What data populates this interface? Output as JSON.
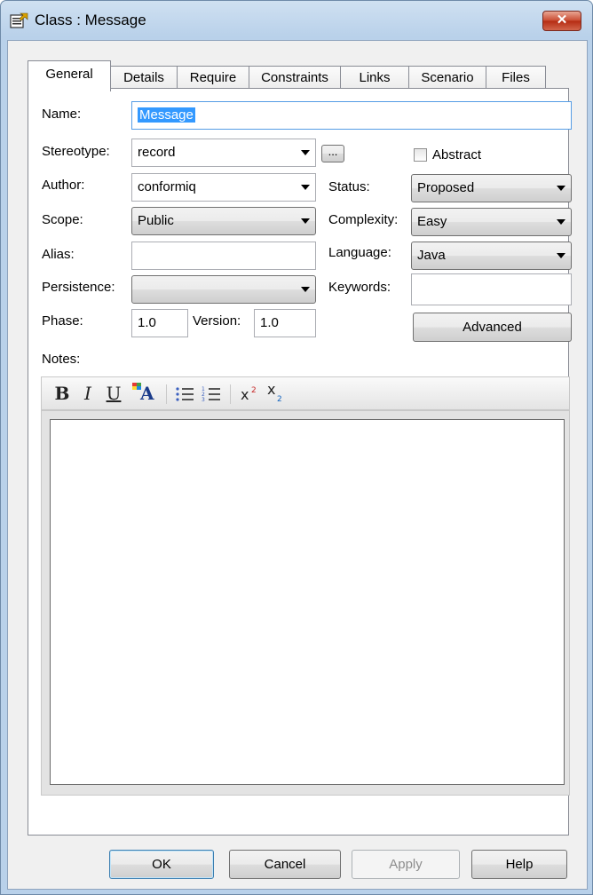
{
  "window": {
    "title": "Class : Message",
    "close_label": "✕"
  },
  "tabs": [
    "General",
    "Details",
    "Require",
    "Constraints",
    "Links",
    "Scenario",
    "Files"
  ],
  "form": {
    "name_label": "Name:",
    "name_value": "Message",
    "stereotype_label": "Stereotype:",
    "stereotype_value": "record",
    "ellipsis_label": "...",
    "abstract_label": "Abstract",
    "author_label": "Author:",
    "author_value": "conformiq",
    "status_label": "Status:",
    "status_value": "Proposed",
    "scope_label": "Scope:",
    "scope_value": "Public",
    "complexity_label": "Complexity:",
    "complexity_value": "Easy",
    "alias_label": "Alias:",
    "alias_value": "",
    "language_label": "Language:",
    "language_value": "Java",
    "persistence_label": "Persistence:",
    "persistence_value": "",
    "keywords_label": "Keywords:",
    "keywords_value": "",
    "phase_label": "Phase:",
    "phase_value": "1.0",
    "version_label": "Version:",
    "version_value": "1.0",
    "advanced_label": "Advanced",
    "notes_label": "Notes:"
  },
  "toolbar": {
    "bold": "B",
    "italic": "I",
    "underline": "U",
    "font_color": "A"
  },
  "buttons": {
    "ok": "OK",
    "cancel": "Cancel",
    "apply": "Apply",
    "help": "Help"
  }
}
